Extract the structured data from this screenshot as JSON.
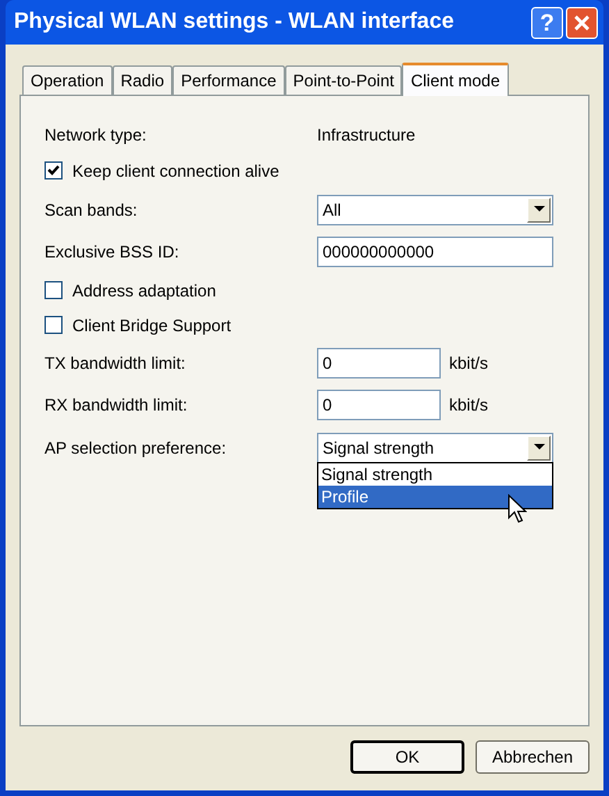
{
  "window": {
    "title": "Physical WLAN settings - WLAN interface",
    "help_button": "?"
  },
  "tabs": [
    {
      "label": "Operation",
      "selected": false
    },
    {
      "label": "Radio",
      "selected": false
    },
    {
      "label": "Performance",
      "selected": false
    },
    {
      "label": "Point-to-Point",
      "selected": false
    },
    {
      "label": "Client mode",
      "selected": true
    }
  ],
  "fields": [
    {
      "kind": "text",
      "label": "Network type:",
      "value": "Infrastructure"
    },
    {
      "kind": "checkbox",
      "label": "Keep client connection alive",
      "checked": true
    },
    {
      "kind": "select",
      "label": "Scan bands:",
      "value": "All"
    },
    {
      "kind": "input",
      "label": "Exclusive BSS ID:",
      "value": "000000000000"
    },
    {
      "kind": "checkbox",
      "label": "Address adaptation",
      "checked": false
    },
    {
      "kind": "checkbox",
      "label": "Client Bridge Support",
      "checked": false
    },
    {
      "kind": "input",
      "label": "TX bandwidth limit:",
      "value": "0",
      "unit": "kbit/s"
    },
    {
      "kind": "input",
      "label": "RX bandwidth limit:",
      "value": "0",
      "unit": "kbit/s"
    },
    {
      "kind": "select",
      "label": "AP selection preference:",
      "value": "Signal strength",
      "options": [
        {
          "label": "Signal strength",
          "highlighted": false
        },
        {
          "label": "Profile",
          "highlighted": true
        }
      ]
    }
  ],
  "buttons": [
    {
      "label": "OK",
      "default": true
    },
    {
      "label": "Abbrechen",
      "default": false
    }
  ]
}
